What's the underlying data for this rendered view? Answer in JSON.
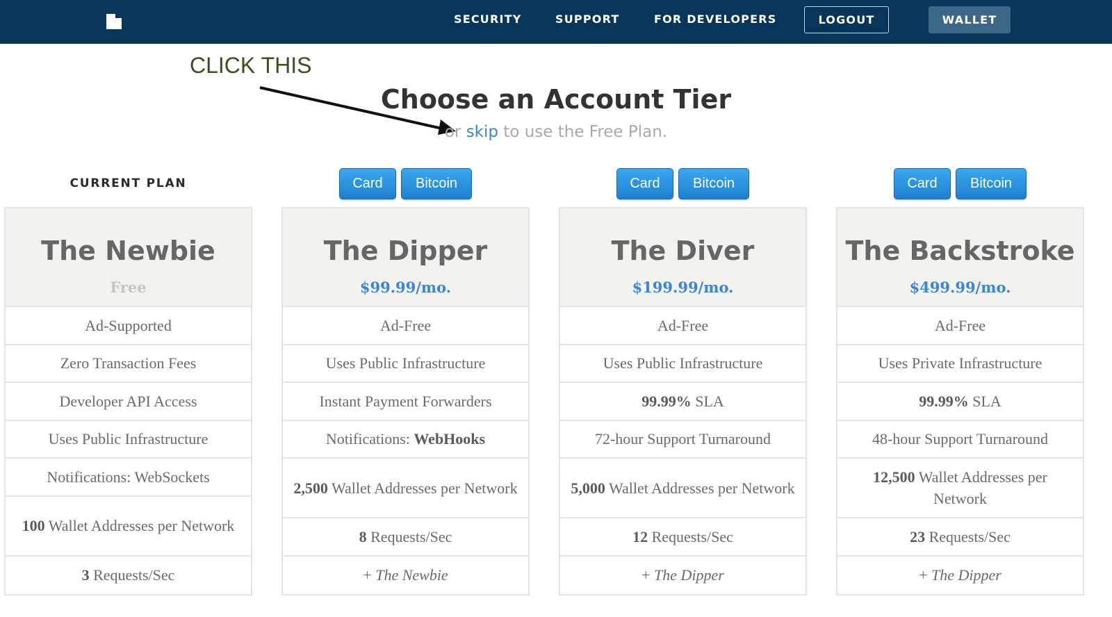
{
  "nav": {
    "links": [
      "SECURITY",
      "SUPPORT",
      "FOR DEVELOPERS"
    ],
    "logout_label": "LOGOUT",
    "wallet_label": "WALLET"
  },
  "annotation": {
    "text": "CLICK THIS"
  },
  "heading": {
    "title": "Choose an Account Tier",
    "sub_prefix": "or ",
    "sub_link": "skip",
    "sub_suffix": " to use the Free Plan."
  },
  "colors": {
    "nav_bg": "#07365a",
    "accent": "#3a86d6",
    "button": "#2b93e0",
    "annotation": "#35521f"
  },
  "tiers": [
    {
      "status_label": "CURRENT PLAN",
      "name": "The Newbie",
      "price": "Free",
      "features": [
        {
          "prefix": "",
          "bold": "",
          "suffix": "Ad-Supported"
        },
        {
          "prefix": "",
          "bold": "",
          "suffix": "Zero Transaction Fees"
        },
        {
          "prefix": "",
          "bold": "",
          "suffix": "Developer API Access"
        },
        {
          "prefix": "",
          "bold": "",
          "suffix": "Uses Public Infrastructure"
        },
        {
          "prefix": "",
          "bold": "",
          "suffix": "Notifications: WebSockets"
        },
        {
          "prefix": "",
          "bold": "100",
          "suffix": " Wallet Addresses per Network"
        },
        {
          "prefix": "",
          "bold": "3",
          "suffix": " Requests/Sec"
        }
      ]
    },
    {
      "card_label": "Card",
      "bitcoin_label": "Bitcoin",
      "name": "The Dipper",
      "price": "$99.99/mo.",
      "features": [
        {
          "prefix": "",
          "bold": "",
          "suffix": "Ad-Free"
        },
        {
          "prefix": "",
          "bold": "",
          "suffix": "Uses Public Infrastructure"
        },
        {
          "prefix": "",
          "bold": "",
          "suffix": "Instant Payment Forwarders"
        },
        {
          "prefix": "Notifications: ",
          "bold": "WebHooks",
          "suffix": ""
        },
        {
          "prefix": "",
          "bold": "2,500",
          "suffix": " Wallet Addresses per Network"
        },
        {
          "prefix": "",
          "bold": "8",
          "suffix": " Requests/Sec"
        },
        {
          "prefix": "+ ",
          "italic": "The Newbie"
        }
      ]
    },
    {
      "card_label": "Card",
      "bitcoin_label": "Bitcoin",
      "name": "The Diver",
      "price": "$199.99/mo.",
      "features": [
        {
          "prefix": "",
          "bold": "",
          "suffix": "Ad-Free"
        },
        {
          "prefix": "",
          "bold": "",
          "suffix": "Uses Public Infrastructure"
        },
        {
          "prefix": "",
          "bold": "99.99%",
          "suffix": " SLA"
        },
        {
          "prefix": "",
          "bold": "",
          "suffix": "72-hour Support Turnaround"
        },
        {
          "prefix": "",
          "bold": "5,000",
          "suffix": " Wallet Addresses per Network"
        },
        {
          "prefix": "",
          "bold": "12",
          "suffix": " Requests/Sec"
        },
        {
          "prefix": "+ ",
          "italic": "The Dipper"
        }
      ]
    },
    {
      "card_label": "Card",
      "bitcoin_label": "Bitcoin",
      "name": "The Backstroke",
      "price": "$499.99/mo.",
      "features": [
        {
          "prefix": "",
          "bold": "",
          "suffix": "Ad-Free"
        },
        {
          "prefix": "",
          "bold": "",
          "suffix": "Uses Private Infrastructure"
        },
        {
          "prefix": "",
          "bold": "99.99%",
          "suffix": " SLA"
        },
        {
          "prefix": "",
          "bold": "",
          "suffix": "48-hour Support Turnaround"
        },
        {
          "prefix": "",
          "bold": "12,500",
          "suffix": " Wallet Addresses per Network"
        },
        {
          "prefix": "",
          "bold": "23",
          "suffix": " Requests/Sec"
        },
        {
          "prefix": "+ ",
          "italic": "The Dipper"
        }
      ]
    }
  ]
}
